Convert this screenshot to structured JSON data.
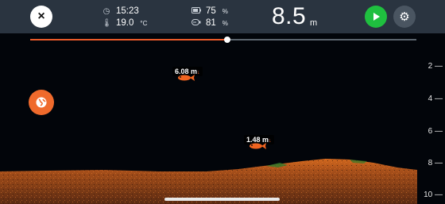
{
  "header": {
    "close_label": "×",
    "time": {
      "icon": "clock-icon",
      "value": "15:23"
    },
    "temperature": {
      "icon": "thermometer-icon",
      "value": "19.0",
      "unit": "°C"
    },
    "battery": {
      "icon": "battery-icon",
      "value": "75",
      "unit": "%"
    },
    "signal": {
      "icon": "signal-icon",
      "value": "81",
      "unit": "%"
    },
    "depth": {
      "value": "8.5",
      "unit": "m"
    },
    "play_icon": "play-icon",
    "settings_icon": "gear-icon"
  },
  "playback": {
    "progress_fraction": 0.51
  },
  "depth_scale": [
    "2",
    "4",
    "6",
    "8",
    "10"
  ],
  "fish": [
    {
      "label": "6.08 m",
      "arrow": "↓"
    },
    {
      "label": "1.48 m",
      "arrow": "↓"
    }
  ],
  "map_button_icon": "globe-icon",
  "colors": {
    "accent": "#ef6a2c",
    "play": "#1fbf3f",
    "topbar": "#2a3440",
    "bottom": "#b8551c"
  }
}
